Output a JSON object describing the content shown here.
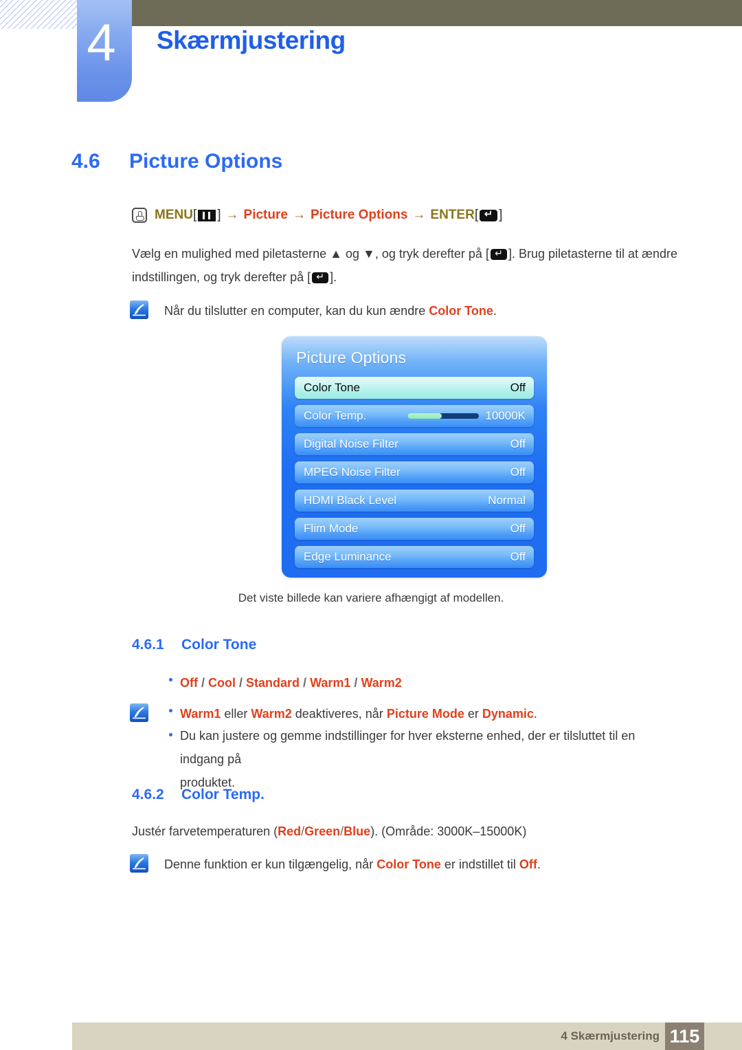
{
  "header": {
    "chapter_number": "4",
    "chapter_title": "Skærmjustering"
  },
  "section": {
    "number": "4.6",
    "title": "Picture Options"
  },
  "nav_path": {
    "hand_icon": "hand-click-icon",
    "menu_label": "MENU",
    "menu_icon": "menu-bars-icon",
    "arrow": "→",
    "bracket_open": "[",
    "bracket_close": "]",
    "step_picture": "Picture",
    "step_picture_options": "Picture Options",
    "enter_label": "ENTER",
    "enter_icon": "enter-key-icon"
  },
  "intro": {
    "line1_a": "Vælg en mulighed med piletasterne ",
    "up_arrow": "▲",
    "line1_b": " og ",
    "down_arrow": "▼",
    "line1_c": ", og tryk derefter på [",
    "line1_d": "]. Brug piletasterne til at ændre",
    "line2_a": "indstillingen, og tryk derefter på [",
    "line2_b": "]."
  },
  "note_top": {
    "icon": "note-quill-icon",
    "text_a": "Når du tilslutter en computer, kan du kun ændre ",
    "keyword": "Color Tone",
    "text_b": "."
  },
  "osd": {
    "title": "Picture Options",
    "rows": [
      {
        "label": "Color Tone",
        "value": "Off",
        "selected": true,
        "type": "value"
      },
      {
        "label": "Color Temp.",
        "value": "10000K",
        "selected": false,
        "type": "slider",
        "slider_percent": 48
      },
      {
        "label": "Digital Noise Filter",
        "value": "Off",
        "selected": false,
        "type": "value"
      },
      {
        "label": "MPEG Noise Filter",
        "value": "Off",
        "selected": false,
        "type": "value"
      },
      {
        "label": "HDMI Black Level",
        "value": "Normal",
        "selected": false,
        "type": "value"
      },
      {
        "label": "Flim Mode",
        "value": "Off",
        "selected": false,
        "type": "value"
      },
      {
        "label": "Edge Luminance",
        "value": "Off",
        "selected": false,
        "type": "value"
      }
    ],
    "caption": "Det viste billede kan variere afhængigt af modellen."
  },
  "subsection_1": {
    "number": "4.6.1",
    "title": "Color Tone",
    "options": [
      "Off",
      "Cool",
      "Standard",
      "Warm1",
      "Warm2"
    ],
    "option_separator": "/",
    "notes": {
      "icon": "note-quill-icon",
      "note1": {
        "kw1": "Warm1",
        "mid1": " eller ",
        "kw2": "Warm2",
        "mid2": " deaktiveres, når ",
        "kw3": "Picture Mode",
        "mid3": " er ",
        "kw4": "Dynamic",
        "end": "."
      },
      "note2_line1": "Du kan justere og gemme indstillinger for hver eksterne enhed, der er tilsluttet til en indgang på",
      "note2_line2": "produktet."
    }
  },
  "subsection_2": {
    "number": "4.6.2",
    "title": "Color Temp.",
    "body_a": "Justér farvetemperaturen (",
    "kw_red": "Red",
    "kw_green": "Green",
    "kw_blue": "Blue",
    "body_b": "). (Område: 3000K–15000K)",
    "note": {
      "icon": "note-quill-icon",
      "text_a": "Denne funktion er kun tilgængelig, når ",
      "kw1": "Color Tone",
      "text_b": " er indstillet til ",
      "kw2": "Off",
      "text_c": "."
    }
  },
  "footer": {
    "label": "4 Skærmjustering",
    "page": "115"
  },
  "colors": {
    "heading_blue": "#2b6af5",
    "keyword_orange": "#e0411c",
    "menu_olive": "#8a7519",
    "band_olive": "#6d6a56",
    "footer_tan": "#d9d4c1",
    "footer_brown": "#8c8073",
    "osd_blue": "#1f6cf0",
    "osd_selected": "#c3f4ef"
  }
}
